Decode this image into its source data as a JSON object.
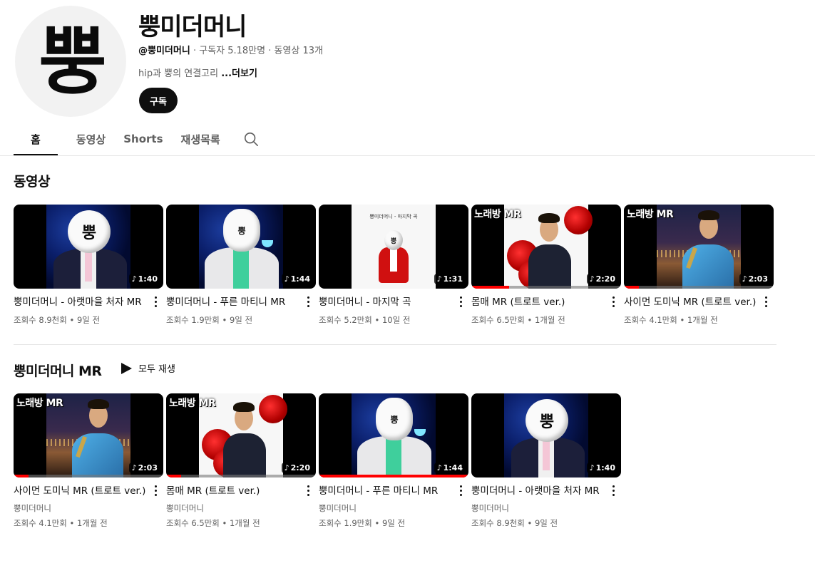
{
  "channel": {
    "avatar_text": "뿡",
    "name": "뿡미더머니",
    "handle": "@뿡미더머니",
    "subscribers": " · 구독자 5.18만명",
    "video_count": " · 동영상 13개",
    "description": "hip과 뿡의 연결고리 ",
    "more_label": "...더보기",
    "subscribe_label": "구독"
  },
  "tabs": [
    {
      "label": "홈",
      "active": true
    },
    {
      "label": "동영상"
    },
    {
      "label": "Shorts"
    },
    {
      "label": "재생목록"
    }
  ],
  "sections": {
    "videos_title": "동영상",
    "mr_title": "뿡미더머니 MR",
    "play_all_label": "모두 재생"
  },
  "videos_row": [
    {
      "title": "뿡미더머니 - 아랫마을 처자 MR",
      "views": "조회수 8.9천회",
      "age": "9일 전",
      "duration": "1:40",
      "art": "blue-suit"
    },
    {
      "title": "뿡미더머니 - 푸른 마티니 MR",
      "views": "조회수 1.9만회",
      "age": "9일 전",
      "duration": "1:44",
      "art": "white-suit"
    },
    {
      "title": "뿡미더머니 - 마지막 곡",
      "views": "조회수 5.2만회",
      "age": "10일 전",
      "duration": "1:31",
      "art": "red-suit",
      "caption": "뿡미더머니 - 마지막 곡"
    },
    {
      "title": "몸매 MR (트로트 ver.)",
      "views": "조회수 6.5만회",
      "age": "1개월 전",
      "duration": "2:20",
      "art": "roses",
      "badge": "노래방 MR"
    },
    {
      "title": "사이먼 도미닉 MR (트로트 ver.)",
      "views": "조회수 4.1만회",
      "age": "1개월 전",
      "duration": "2:03",
      "art": "city",
      "badge": "노래방 MR"
    }
  ],
  "mr_row": [
    {
      "title": "사이먼 도미닉 MR (트로트 ver.)",
      "channel": "뿡미더머니",
      "views": "조회수 4.1만회",
      "age": "1개월 전",
      "duration": "2:03",
      "art": "city",
      "badge": "노래방 MR"
    },
    {
      "title": "몸매 MR (트로트 ver.)",
      "channel": "뿡미더머니",
      "views": "조회수 6.5만회",
      "age": "1개월 전",
      "duration": "2:20",
      "art": "roses",
      "badge": "노래방 MR"
    },
    {
      "title": "뿡미더머니 - 푸른 마티니 MR",
      "channel": "뿡미더머니",
      "views": "조회수 1.9만회",
      "age": "9일 전",
      "duration": "1:44",
      "art": "white-suit"
    },
    {
      "title": "뿡미더머니 - 아랫마을 처자 MR",
      "channel": "뿡미더머니",
      "views": "조회수 8.9천회",
      "age": "9일 전",
      "duration": "1:40",
      "art": "blue-suit"
    }
  ],
  "separator": " • ",
  "colors": {
    "accent": "#ff0000",
    "text": "#0f0f0f",
    "muted": "#606060"
  }
}
